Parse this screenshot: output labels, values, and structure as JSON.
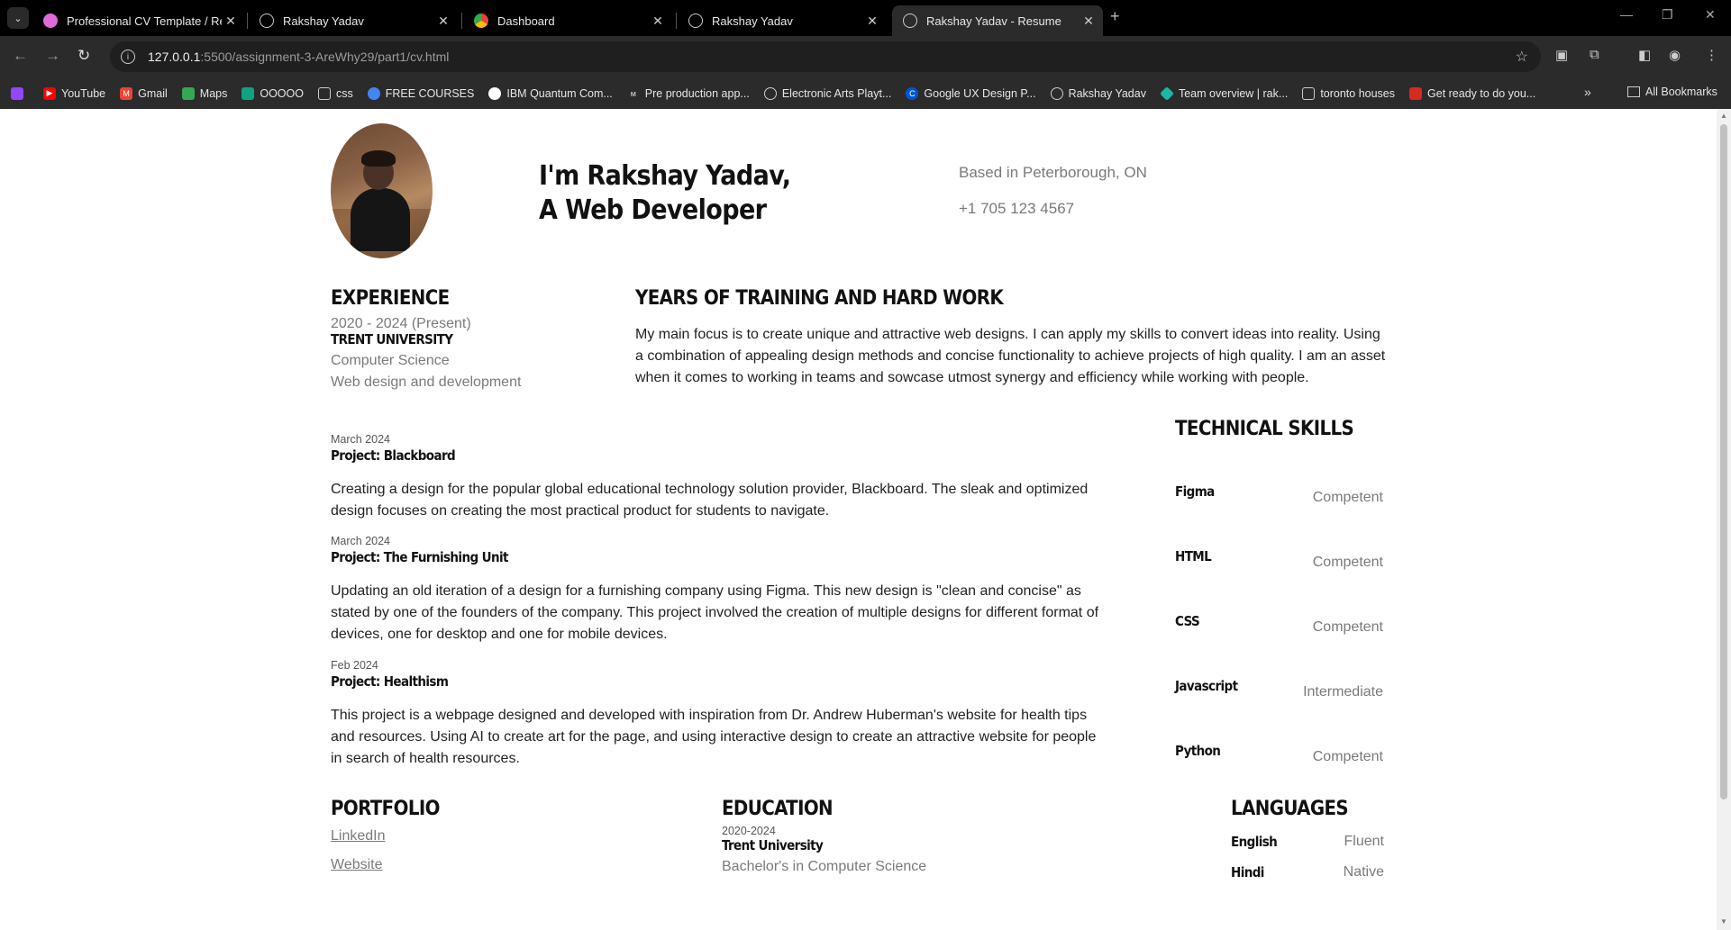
{
  "browser": {
    "tabs": [
      {
        "title": "Professional CV Template / Res",
        "icon": "figma-icon",
        "active": false
      },
      {
        "title": "Rakshay Yadav",
        "icon": "globe-icon",
        "active": false
      },
      {
        "title": "Dashboard",
        "icon": "chrome-icon",
        "active": false
      },
      {
        "title": "Rakshay Yadav",
        "icon": "globe-icon",
        "active": false
      },
      {
        "title": "Rakshay Yadav - Resume",
        "icon": "globe-icon",
        "active": true
      }
    ],
    "url_host": "127.0.0.1",
    "url_path": ":5500/assignment-3-AreWhy29/part1/cv.html",
    "bookmarks": [
      {
        "label": "YouTube",
        "icon": "youtube-icon",
        "color": "#ff0000"
      },
      {
        "label": "Gmail",
        "icon": "gmail-icon",
        "color": "#ea4335"
      },
      {
        "label": "Maps",
        "icon": "maps-icon",
        "color": "#34a853"
      },
      {
        "label": "OOOOO",
        "icon": "openai-icon",
        "color": "#10a37f"
      },
      {
        "label": "css",
        "icon": "folder-icon",
        "color": "#2b2b2b"
      },
      {
        "label": "FREE COURSES",
        "icon": "google-icon",
        "color": "#4285f4"
      },
      {
        "label": "IBM Quantum Com...",
        "icon": "ibm-icon",
        "color": "#ffffff"
      },
      {
        "label": "Pre production app...",
        "icon": "m-icon",
        "color": "#2b2b2b"
      },
      {
        "label": "Electronic Arts Playt...",
        "icon": "globe-icon",
        "color": "#2b2b2b"
      },
      {
        "label": "Google UX Design P...",
        "icon": "coursera-icon",
        "color": "#0056d2"
      },
      {
        "label": "Rakshay Yadav",
        "icon": "globe-icon",
        "color": "#2b2b2b"
      },
      {
        "label": "Team overview | rak...",
        "icon": "diamond-icon",
        "color": "#1fb6a6"
      },
      {
        "label": "toronto houses",
        "icon": "folder-icon",
        "color": "#2b2b2b"
      },
      {
        "label": "Get ready to do you...",
        "icon": "maple-leaf-icon",
        "color": "#d52b1e"
      }
    ],
    "all_bookmarks": "All Bookmarks",
    "more": "»"
  },
  "header": {
    "intro_line1": "I'm Rakshay Yadav,",
    "intro_line2": "A Web Developer",
    "location": "Based in Peterborough, ON",
    "phone": "+1 705 123 4567"
  },
  "experience": {
    "heading": "EXPERIENCE",
    "dates": "2020 - 2024 (Present)",
    "org": "TRENT UNIVERSITY",
    "line1": "Computer Science",
    "line2": "Web design and development"
  },
  "about": {
    "heading": "YEARS OF TRAINING AND HARD WORK",
    "text": "My main focus is to create unique and attractive web designs. I can apply my skills to convert ideas into reality. Using a combination of appealing design methods and concise functionality to achieve projects of high quality. I am an asset when it comes to working in teams and sowcase utmost synergy and efficiency while working with people."
  },
  "projects": [
    {
      "date": "March 2024",
      "title": "Project: Blackboard",
      "text": "Creating a design for the popular global educational technology solution provider, Blackboard. The sleak and optimized design focuses on creating the most practical product for students to navigate."
    },
    {
      "date": "March 2024",
      "title": "Project: The Furnishing Unit",
      "text": "Updating an old iteration of a design for a furnishing company using Figma. This new design is \"clean and concise\" as stated by one of the founders of the company. This project involved the creation of multiple designs for different format of devices, one for desktop and one for mobile devices."
    },
    {
      "date": "Feb 2024",
      "title": "Project: Healthism",
      "text": "This project is a webpage designed and developed with inspiration from Dr. Andrew Huberman's website for health tips and resources. Using AI to create art for the page, and using interactive design to create an attractive website for people in search of health resources."
    }
  ],
  "skills": {
    "heading": "TECHNICAL SKILLS",
    "items": [
      {
        "name": "Figma",
        "level": "Competent"
      },
      {
        "name": "HTML",
        "level": "Competent"
      },
      {
        "name": "CSS",
        "level": "Competent"
      },
      {
        "name": "Javascript",
        "level": "Intermediate"
      },
      {
        "name": "Python",
        "level": "Competent"
      }
    ]
  },
  "portfolio": {
    "heading": "PORTFOLIO",
    "links": [
      "LinkedIn",
      "Website"
    ]
  },
  "education": {
    "heading": "EDUCATION",
    "dates": "2020-2024",
    "school": "Trent University",
    "degree": "Bachelor's in Computer Science"
  },
  "languages": {
    "heading": "LANGUAGES",
    "items": [
      {
        "name": "English",
        "level": "Fluent"
      },
      {
        "name": "Hindi",
        "level": "Native"
      }
    ]
  }
}
